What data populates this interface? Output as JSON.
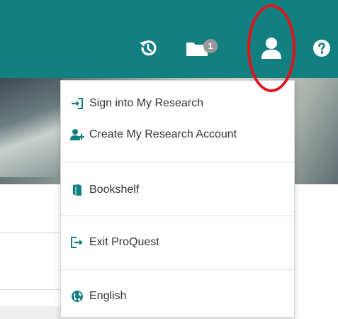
{
  "header": {
    "folder_count": "1",
    "colors": {
      "bar": "#127f80",
      "icon": "#ffffff",
      "annotation": "#e0141b",
      "accent": "#127f80"
    }
  },
  "dropdown": {
    "items": [
      {
        "label": "Sign into My Research",
        "icon": "sign-in-icon"
      },
      {
        "label": "Create My Research Account",
        "icon": "add-user-icon"
      },
      {
        "label": "Bookshelf",
        "icon": "book-icon"
      },
      {
        "label": "Exit ProQuest",
        "icon": "sign-out-icon"
      },
      {
        "label": "English",
        "icon": "globe-icon"
      }
    ]
  }
}
